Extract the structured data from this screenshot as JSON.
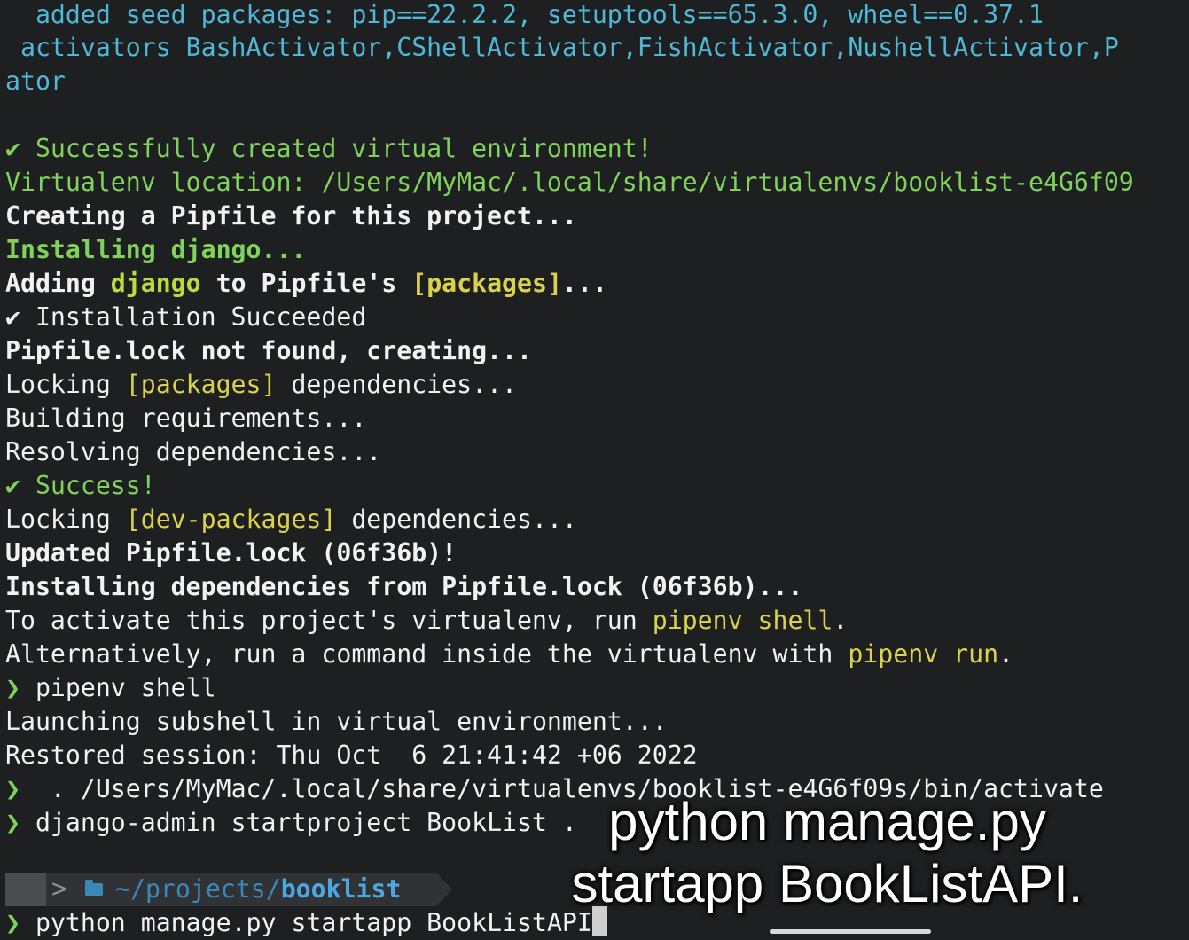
{
  "terminal": {
    "lines": [
      {
        "parts": [
          {
            "text": "  added seed packages: pip==22.2.2, setuptools==65.3.0, wheel==0.37.1"
          }
        ]
      },
      {
        "parts": [
          {
            "text": " activators BashActivator,CShellActivator,FishActivator,NushellActivator,P"
          }
        ]
      },
      {
        "parts": [
          {
            "text": "ator"
          }
        ]
      },
      {
        "parts": [
          {
            "text": "✔ Successfully created virtual environment!"
          }
        ]
      },
      {
        "parts": [
          {
            "text": "Virtualenv location: /Users/MyMac/.local/share/virtualenvs/booklist-e4G6f09"
          }
        ]
      },
      {
        "parts": [
          {
            "text": "Creating a Pipfile for this project..."
          }
        ]
      },
      {
        "parts": [
          {
            "text": "Installing django..."
          }
        ]
      },
      {
        "parts": [
          {
            "text": "Adding "
          },
          {
            "text": "django"
          },
          {
            "text": " to Pipfile's "
          },
          {
            "text": "[packages]"
          },
          {
            "text": "..."
          }
        ]
      },
      {
        "parts": [
          {
            "text": "✔ Installation Succeeded"
          }
        ]
      },
      {
        "parts": [
          {
            "text": "Pipfile.lock not found, creating..."
          }
        ]
      },
      {
        "parts": [
          {
            "text": "Locking "
          },
          {
            "text": "[packages]"
          },
          {
            "text": " dependencies..."
          }
        ]
      },
      {
        "parts": [
          {
            "text": "Building requirements..."
          }
        ]
      },
      {
        "parts": [
          {
            "text": "Resolving dependencies..."
          }
        ]
      },
      {
        "parts": [
          {
            "text": "✔ Success!"
          }
        ]
      },
      {
        "parts": [
          {
            "text": "Locking "
          },
          {
            "text": "[dev-packages]"
          },
          {
            "text": " dependencies..."
          }
        ]
      },
      {
        "parts": [
          {
            "text": "Updated Pipfile.lock (06f36b)!"
          }
        ]
      },
      {
        "parts": [
          {
            "text": "Installing dependencies from Pipfile.lock (06f36b)..."
          }
        ]
      },
      {
        "parts": [
          {
            "text": "To activate this project's virtualenv, run "
          },
          {
            "text": "pipenv shell"
          },
          {
            "text": "."
          }
        ]
      },
      {
        "parts": [
          {
            "text": "Alternatively, run a command inside the virtualenv with "
          },
          {
            "text": "pipenv run"
          },
          {
            "text": "."
          }
        ]
      },
      {
        "parts": [
          {
            "text": "❯"
          },
          {
            "text": " pipenv shell"
          }
        ]
      },
      {
        "parts": [
          {
            "text": "Launching subshell in virtual environment..."
          }
        ]
      },
      {
        "parts": [
          {
            "text": "Restored session: Thu Oct  6 21:41:42 +06 2022"
          }
        ]
      },
      {
        "parts": [
          {
            "text": "❯"
          },
          {
            "text": "  . /Users/MyMac/.local/share/virtualenvs/booklist-e4G6f09s/bin/activate"
          }
        ]
      },
      {
        "parts": [
          {
            "text": "❯"
          },
          {
            "text": " django-admin startproject BookList ."
          }
        ]
      }
    ],
    "prompt": {
      "chevron": ">",
      "folder_icon": "folder-icon",
      "path_prefix": "~/projects/",
      "path_dir": "booklist"
    },
    "input_line": {
      "prompt_symbol": "❯",
      "command": " python manage.py startapp BookListAPI"
    }
  },
  "caption": {
    "line1": "python manage.py",
    "line2": "startapp BookListAPI."
  },
  "colors": {
    "background": "#1e1f21",
    "cyan": "#4fb8d6",
    "green": "#7fd35a",
    "yellow": "#dad24a",
    "path_blue": "#3a88b8"
  }
}
